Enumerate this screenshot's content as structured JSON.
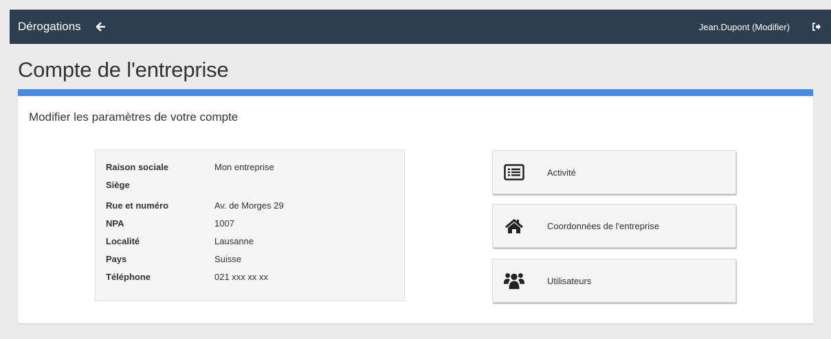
{
  "navbar": {
    "brand": "Dérogations",
    "back_icon": "arrow-left-icon",
    "user": "Jean.Dupont (Modifier)",
    "logout_icon": "sign-out-icon"
  },
  "page": {
    "title": "Compte de l'entreprise"
  },
  "panel": {
    "accent_color": "#4a8cdb",
    "subtitle": "Modifier les paramètres de votre compte"
  },
  "company_info": [
    {
      "label": "Raison sociale",
      "value": "Mon entreprise"
    },
    {
      "label": "Siège",
      "value": ""
    },
    {
      "label": "Rue et numéro",
      "value": "Av. de Morges 29"
    },
    {
      "label": "NPA",
      "value": "1007"
    },
    {
      "label": "Localité",
      "value": "Lausanne"
    },
    {
      "label": "Pays",
      "value": "Suisse"
    },
    {
      "label": "Téléphone",
      "value": "021 xxx xx xx"
    }
  ],
  "actions": [
    {
      "label": "Activité",
      "icon": "list-alt-icon"
    },
    {
      "label": "Coordonnées de l'entreprise",
      "icon": "home-icon"
    },
    {
      "label": "Utilisateurs",
      "icon": "users-icon"
    }
  ],
  "colors": {
    "navbar": "#2c3e50",
    "background": "#ebebeb"
  }
}
